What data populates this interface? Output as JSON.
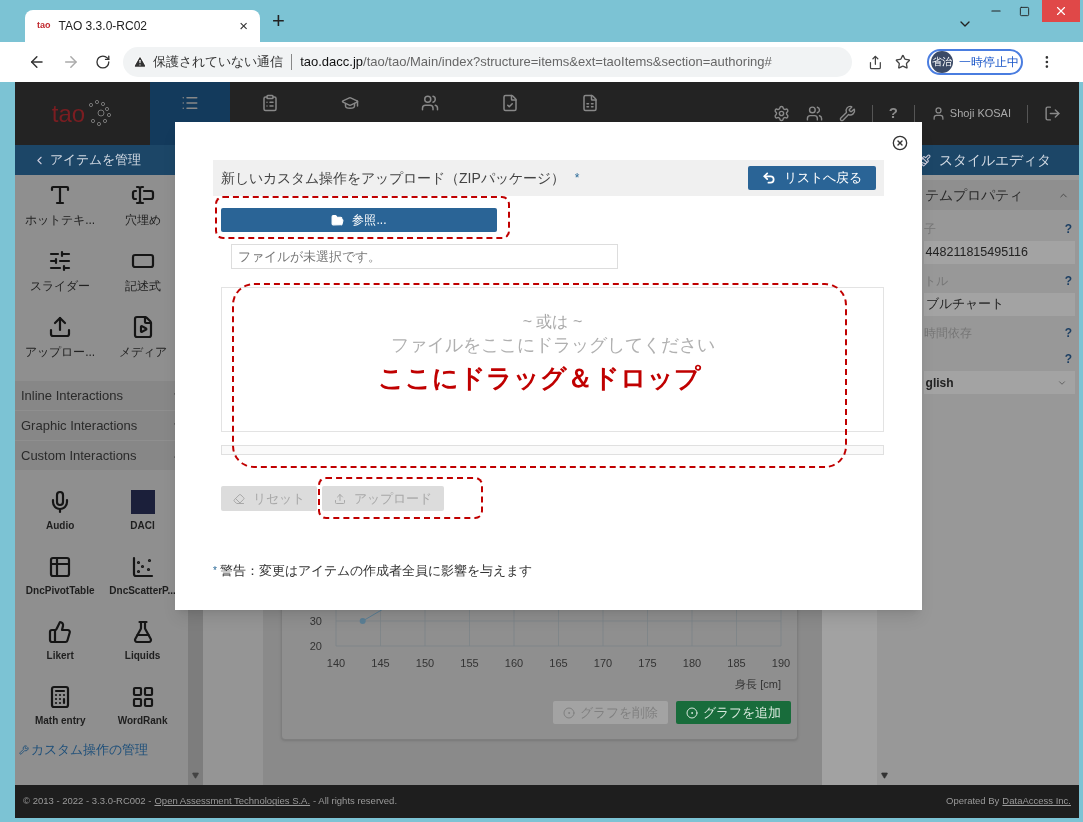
{
  "browser": {
    "tab": {
      "favicon": "tao",
      "title": "TAO 3.3.0-RC02",
      "close": "×"
    },
    "new_tab": "+",
    "security_label": "保護されていない通信",
    "url_domain": "tao.dacc.jp",
    "url_path": "/tao/tao/Main/index?structure=items&ext=taoItems&section=authoring#",
    "profile": {
      "avatar": "省治",
      "status": "一時停止中"
    }
  },
  "app_header": {
    "logo": "tao",
    "nav_tabs": [
      {
        "selected": true
      },
      {
        "selected": false
      },
      {
        "selected": false
      },
      {
        "selected": false
      },
      {
        "selected": false
      },
      {
        "selected": false
      }
    ],
    "help": "?",
    "user": "Shoji KOSAI"
  },
  "left_panel": {
    "title": "アイテムを管理",
    "tools": [
      {
        "kind": "hottext",
        "label": "ホットテキ..."
      },
      {
        "kind": "gapmatch",
        "label": "穴埋め"
      },
      {
        "kind": "slider",
        "label": "スライダー"
      },
      {
        "kind": "extended",
        "label": "記述式"
      },
      {
        "kind": "upload",
        "label": "アップロー..."
      },
      {
        "kind": "media",
        "label": "メディア"
      }
    ],
    "sections": [
      {
        "label": "Inline Interactions",
        "expanded": false
      },
      {
        "label": "Graphic Interactions",
        "expanded": false
      },
      {
        "label": "Custom Interactions",
        "expanded": true
      }
    ],
    "custom_tools": [
      {
        "kind": "audio",
        "label": "Audio"
      },
      {
        "kind": "daci",
        "label": "DACI"
      },
      {
        "kind": "pivot",
        "label": "DncPivotTable"
      },
      {
        "kind": "scatter",
        "label": "DncScatterP..."
      },
      {
        "kind": "likert",
        "label": "Likert"
      },
      {
        "kind": "liquids",
        "label": "Liquids"
      },
      {
        "kind": "math",
        "label": "Math entry"
      },
      {
        "kind": "wordrank",
        "label": "WordRank"
      }
    ],
    "manage_link": "カスタム操作の管理"
  },
  "right_panel": {
    "title": "スタイルエディタ",
    "section": {
      "title": "テムプロパティ",
      "expanded": true
    },
    "fields": [
      {
        "kind": "text",
        "label": "子",
        "help": "?",
        "value": "448211815495116"
      },
      {
        "kind": "text",
        "label": "トル",
        "help": "?",
        "value": "ブルチャート"
      },
      {
        "kind": "label",
        "label": "時間依存",
        "help": "?"
      },
      {
        "kind": "select",
        "help": "?",
        "value": "glish"
      }
    ]
  },
  "chart": {
    "chart_data": {
      "type": "line",
      "xlabel": "身長 [cm]",
      "xlim": [
        140,
        190
      ],
      "ylim": [
        20,
        30
      ],
      "grid": true,
      "marker": true,
      "x": [
        143
      ],
      "values": [
        30
      ],
      "xticks": [
        140,
        145,
        150,
        155,
        160,
        165,
        170,
        175,
        180,
        185,
        190
      ],
      "yticks": [
        20,
        30
      ]
    },
    "buttons": [
      {
        "label": "グラフを削除",
        "disabled": true
      },
      {
        "label": "グラフを追加",
        "disabled": false
      }
    ]
  },
  "modal": {
    "title": "新しいカスタム操作をアップロード（ZIPパッケージ）",
    "required_mark": "*",
    "back_button": "リストへ戻る",
    "browse_button": "参照...",
    "file_field": {
      "placeholder": "ファイルが未選択です。"
    },
    "drop_zone": {
      "separator": "~ 或は ~",
      "hint": "ファイルをここにドラッグしてください"
    },
    "actions": [
      {
        "kind": "reset",
        "label": "リセット",
        "disabled": true
      },
      {
        "kind": "upload",
        "label": "アップロード",
        "disabled": true
      }
    ],
    "warning": {
      "mark": "*",
      "text": "警告：変更はアイテムの作成者全員に影響を与えます"
    }
  },
  "annotation": {
    "callout": "ここにドラッグ＆ドロップ"
  },
  "footer": {
    "copyright": "© 2013 - 2022 - 3.3.0-RC002 -",
    "company_link": "Open Assessment Technologies S.A.",
    "rights": "- All rights reserved.",
    "operated_by": "Operated By",
    "operator_link": "DataAccess Inc."
  }
}
